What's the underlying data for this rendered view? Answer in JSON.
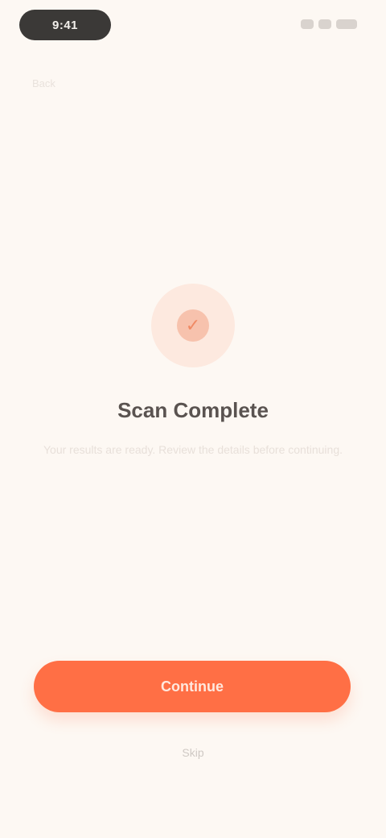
{
  "status_bar": {
    "time": "9:41",
    "icons": [
      "signal-icon",
      "wifi-icon",
      "battery-icon"
    ]
  },
  "header": {
    "back_label": "Back"
  },
  "hero": {
    "icon": "check-icon",
    "title": "Scan Complete",
    "subtitle": "Your results are ready. Review the details before continuing."
  },
  "actions": {
    "primary_label": "Continue",
    "secondary_label": "Skip"
  },
  "colors": {
    "background": "#fdf8f3",
    "accent": "#ff6f45",
    "accent_soft": "#fde9df"
  }
}
